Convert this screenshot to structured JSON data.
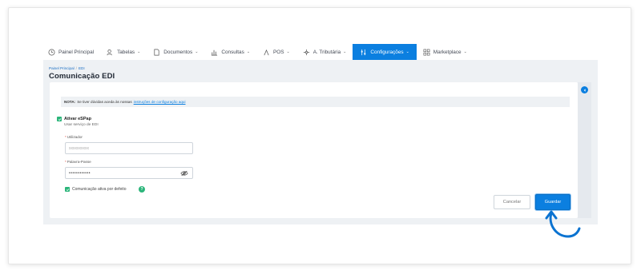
{
  "nav": {
    "items": [
      {
        "label": "Painel Principal",
        "icon": "clock-icon",
        "dropdown": false,
        "active": false
      },
      {
        "label": "Tabelas",
        "icon": "users-icon",
        "dropdown": true,
        "active": false
      },
      {
        "label": "Documentos",
        "icon": "document-icon",
        "dropdown": true,
        "active": false
      },
      {
        "label": "Consultas",
        "icon": "bar-chart-icon",
        "dropdown": true,
        "active": false
      },
      {
        "label": "POS",
        "icon": "pos-icon",
        "dropdown": true,
        "active": false
      },
      {
        "label": "A. Tributária",
        "icon": "network-icon",
        "dropdown": true,
        "active": false
      },
      {
        "label": "Configurações",
        "icon": "sliders-icon",
        "dropdown": true,
        "active": true
      },
      {
        "label": "Marketplace",
        "icon": "grid-icon",
        "dropdown": true,
        "active": false
      }
    ]
  },
  "breadcrumb": {
    "home": "Painel Principal",
    "sep": "/",
    "current": "EDI"
  },
  "page": {
    "title": "Comunicação EDI"
  },
  "note": {
    "prefix": "NOTA:",
    "text": "Se tiver dúvidas aceda às nossas",
    "link": "instruções de configuração aqui"
  },
  "form": {
    "enable_label": "Ativar eSPap",
    "enable_sub": "Usar serviço de EDI",
    "enable_checked": true,
    "username_required": "*",
    "username_label": "Utilizador",
    "username_value": "xxxxxxxxxx",
    "password_required": "*",
    "password_label": "Palavra-Passe",
    "password_value": "••••••••••••",
    "default_checked": true,
    "default_label": "Comunicação ativa por defeito",
    "help": "?"
  },
  "actions": {
    "cancel": "Cancelar",
    "save": "Guardar"
  },
  "colors": {
    "accent": "#0b7fe0",
    "success": "#2bb57a",
    "required": "#e0463b"
  }
}
